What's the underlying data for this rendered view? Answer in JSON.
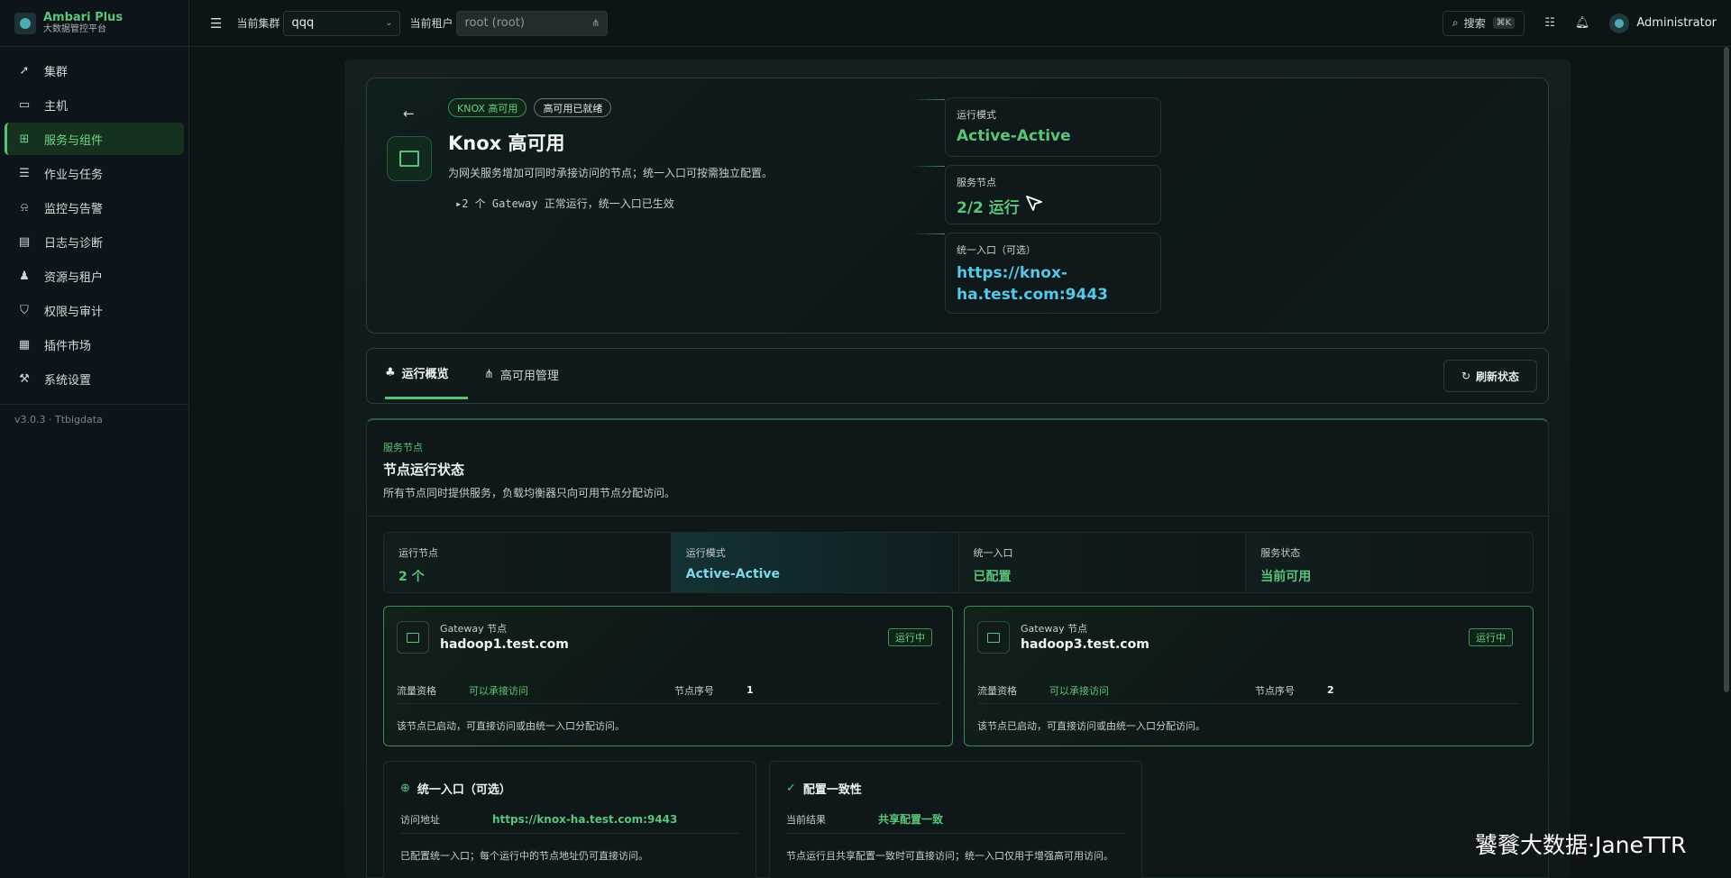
{
  "brand": {
    "title": "Ambari Plus",
    "subtitle": "大数据管控平台"
  },
  "sidebar": {
    "items": [
      {
        "label": "集群",
        "icon": "rocket-icon"
      },
      {
        "label": "主机",
        "icon": "monitor-icon"
      },
      {
        "label": "服务与组件",
        "icon": "grid-icon",
        "active": true
      },
      {
        "label": "作业与任务",
        "icon": "list-icon"
      },
      {
        "label": "监控与告警",
        "icon": "alarm-icon"
      },
      {
        "label": "日志与诊断",
        "icon": "log-search-icon"
      },
      {
        "label": "资源与租户",
        "icon": "users-icon"
      },
      {
        "label": "权限与审计",
        "icon": "shield-icon"
      },
      {
        "label": "插件市场",
        "icon": "puzzle-icon"
      },
      {
        "label": "系统设置",
        "icon": "wrench-icon"
      }
    ],
    "version": "v3.0.3 · Ttbigdata"
  },
  "topbar": {
    "cluster_label": "当前集群",
    "cluster_value": "qqq",
    "tenant_label": "当前租户",
    "tenant_value": "root (root)",
    "search_label": "搜索",
    "search_kbd": "⌘K",
    "user": "Administrator"
  },
  "hero": {
    "badge_tag": "KNOX 高可用",
    "badge_status": "高可用已就绪",
    "title": "Knox 高可用",
    "description": "为网关服务增加可同时承接访问的节点；统一入口可按需独立配置。",
    "detail": "2 个 Gateway 正常运行，统一入口已生效",
    "stats": [
      {
        "label": "运行模式",
        "value": "Active-Active"
      },
      {
        "label": "服务节点",
        "value": "2/2 运行"
      },
      {
        "label": "统一入口（可选）",
        "value_line1": "https://knox-",
        "value_line2": "ha.test.com:9443"
      }
    ]
  },
  "tabs": {
    "items": [
      {
        "label": "运行概览",
        "active": true
      },
      {
        "label": "高可用管理",
        "active": false
      }
    ],
    "refresh_label": "刷新状态"
  },
  "panel": {
    "eyebrow": "服务节点",
    "title": "节点运行状态",
    "description": "所有节点同时提供服务，负载均衡器只向可用节点分配访问。",
    "summary": [
      {
        "label": "运行节点",
        "value": "2 个"
      },
      {
        "label": "运行模式",
        "value": "Active-Active"
      },
      {
        "label": "统一入口",
        "value": "已配置"
      },
      {
        "label": "服务状态",
        "value": "当前可用"
      }
    ],
    "nodes": [
      {
        "kind": "Gateway 节点",
        "host": "hadoop1.test.com",
        "state": "运行中",
        "traffic_label": "流量资格",
        "traffic_value": "可以承接访问",
        "seq_label": "节点序号",
        "seq_value": "1",
        "note": "该节点已启动，可直接访问或由统一入口分配访问。"
      },
      {
        "kind": "Gateway 节点",
        "host": "hadoop3.test.com",
        "state": "运行中",
        "traffic_label": "流量资格",
        "traffic_value": "可以承接访问",
        "seq_label": "节点序号",
        "seq_value": "2",
        "note": "该节点已启动，可直接访问或由统一入口分配访问。"
      }
    ],
    "entry": {
      "title": "统一入口（可选）",
      "row_label": "访问地址",
      "row_value": "https://knox-ha.test.com:9443",
      "note": "已配置统一入口；每个运行中的节点地址仍可直接访问。"
    },
    "consistency": {
      "title": "配置一致性",
      "row_label": "当前结果",
      "row_value": "共享配置一致",
      "note": "节点运行且共享配置一致时可直接访问；统一入口仅用于增强高可用访问。"
    }
  },
  "watermark": "饕餮大数据·JaneTTR"
}
